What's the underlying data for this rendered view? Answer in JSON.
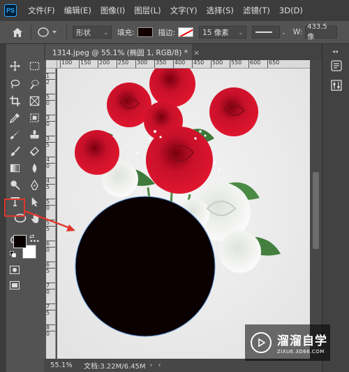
{
  "menubar": {
    "app_icon": "PS",
    "items": [
      "文件(F)",
      "编辑(E)",
      "图像(I)",
      "图层(L)",
      "文字(Y)",
      "选择(S)",
      "滤镜(T)",
      "3D(D)"
    ]
  },
  "options": {
    "mode_value": "形状",
    "fill_label": "填充:",
    "stroke_label": "描边:",
    "stroke_width": "15 像素",
    "w_label": "W:",
    "w_value": "433.5 像",
    "fill_color": "#120000",
    "stroke_color": "#ffffff"
  },
  "document": {
    "tab_title": "1314.jpeg @ 55.1% (椭圆 1, RGB/8) *",
    "ruler_h": [
      "100",
      "150",
      "200",
      "250",
      "300",
      "350",
      "400",
      "450",
      "500",
      "550",
      "600",
      "650"
    ],
    "ruler_v": [
      "1",
      "2",
      "5",
      "0",
      "3",
      "0",
      "3",
      "5",
      "4",
      "0",
      "4",
      "5",
      "5",
      "0",
      "5",
      "5",
      "6",
      "0",
      "6",
      "5",
      "7",
      "0",
      "7",
      "5",
      "8",
      "0"
    ]
  },
  "colors": {
    "foreground": "#0a0000",
    "background": "#ffffff",
    "highlight": "#e0362d",
    "ellipse_fill": "#0a0000"
  },
  "status": {
    "zoom": "55.1%",
    "doc_info": "文档:3.22M/6.45M",
    "arrow": "›"
  },
  "watermark": {
    "title": "溜溜自学",
    "subtitle": "ZIXUE.3D66.COM"
  }
}
